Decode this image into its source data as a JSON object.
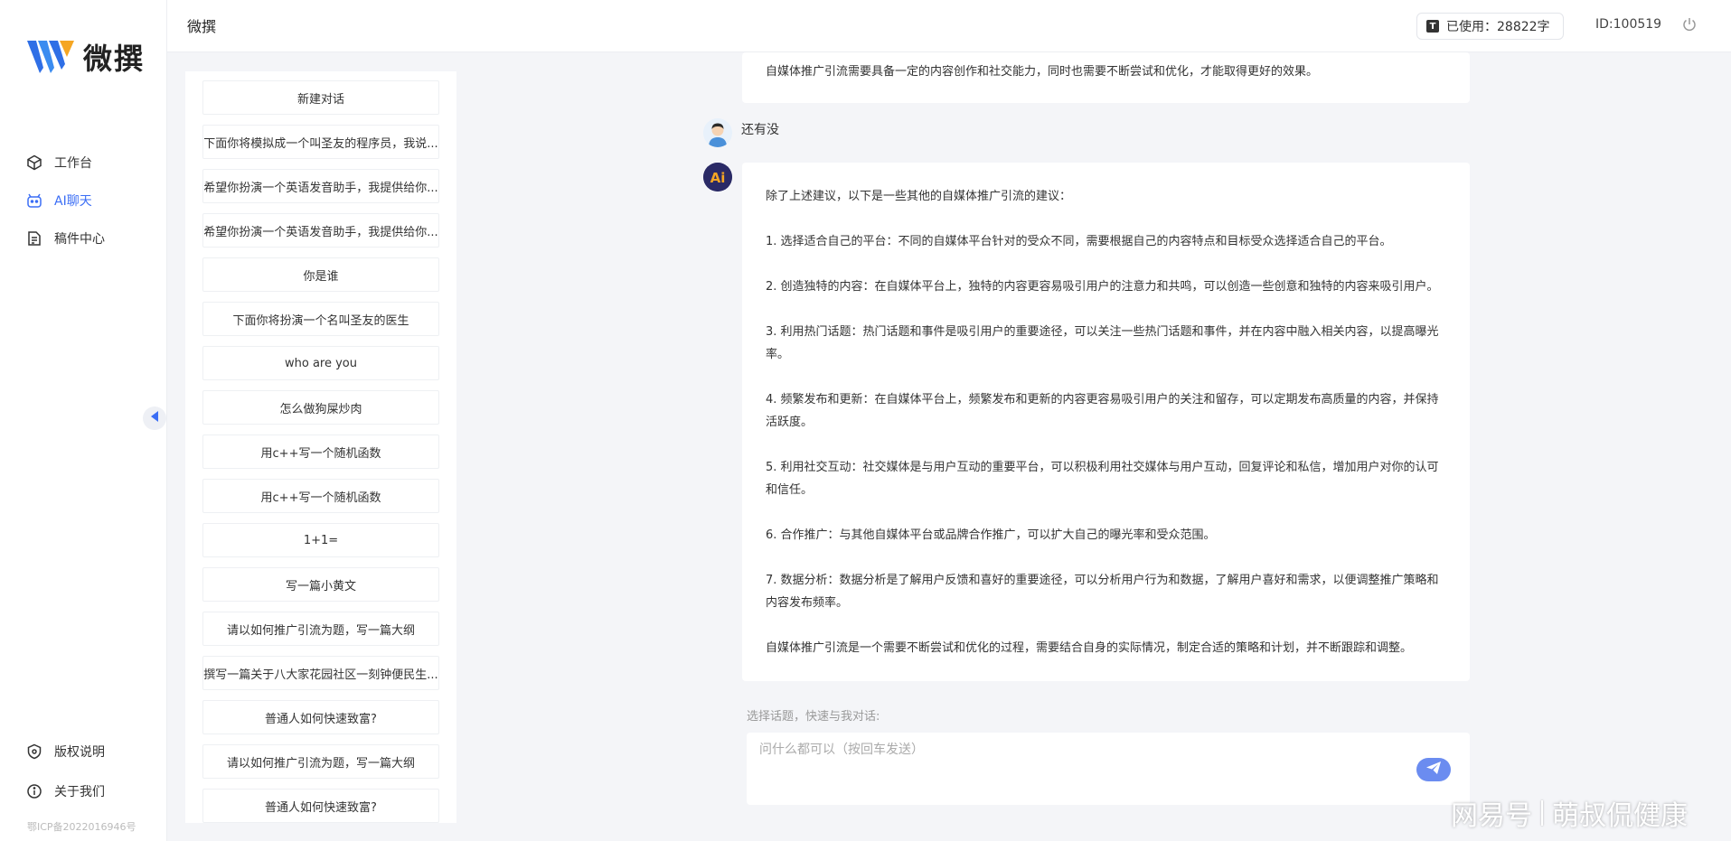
{
  "app": {
    "name": "微撰",
    "page_title": "微撰"
  },
  "nav": {
    "items": [
      {
        "label": "工作台",
        "icon": "cube-icon"
      },
      {
        "label": "AI聊天",
        "icon": "robot-icon",
        "active": true
      },
      {
        "label": "稿件中心",
        "icon": "document-icon"
      }
    ],
    "bottom": [
      {
        "label": "版权说明",
        "icon": "shield-icon"
      },
      {
        "label": "关于我们",
        "icon": "info-icon"
      }
    ],
    "icp": "鄂ICP备2022016946号"
  },
  "header": {
    "usage_label": "已使用：",
    "usage_value": "28822字",
    "user_id": "ID:100519"
  },
  "conversations": {
    "new_chat": "新建对话",
    "items": [
      "下面你将模拟成一个叫圣友的程序员，我说...",
      "希望你扮演一个英语发音助手，我提供给你...",
      "希望你扮演一个英语发音助手，我提供给你...",
      "你是谁",
      "下面你将扮演一个名叫圣友的医生",
      "who are you",
      "怎么做狗屎炒肉",
      "用c++写一个随机函数",
      "用c++写一个随机函数",
      "1+1=",
      "写一篇小黄文",
      "请以如何推广引流为题，写一篇大纲",
      "撰写一篇关于八大家花园社区一刻钟便民生...",
      "普通人如何快速致富?",
      "请以如何推广引流为题，写一篇大纲",
      "普通人如何快速致富?"
    ]
  },
  "chat": {
    "prev_ai_tail": "自媒体推广引流需要具备一定的内容创作和社交能力，同时也需要不断尝试和优化，才能取得更好的效果。",
    "user_message": "还有没",
    "ai_reply": [
      "除了上述建议，以下是一些其他的自媒体推广引流的建议：",
      "1. 选择适合自己的平台：不同的自媒体平台针对的受众不同，需要根据自己的内容特点和目标受众选择适合自己的平台。",
      "2. 创造独特的内容：在自媒体平台上，独特的内容更容易吸引用户的注意力和共鸣，可以创造一些创意和独特的内容来吸引用户。",
      "3. 利用热门话题：热门话题和事件是吸引用户的重要途径，可以关注一些热门话题和事件，并在内容中融入相关内容，以提高曝光率。",
      "4. 频繁发布和更新：在自媒体平台上，频繁发布和更新的内容更容易吸引用户的关注和留存，可以定期发布高质量的内容，并保持活跃度。",
      "5. 利用社交互动：社交媒体是与用户互动的重要平台，可以积极利用社交媒体与用户互动，回复评论和私信，增加用户对你的认可和信任。",
      "6. 合作推广：与其他自媒体平台或品牌合作推广，可以扩大自己的曝光率和受众范围。",
      "7. 数据分析：数据分析是了解用户反馈和喜好的重要途径，可以分析用户行为和数据，了解用户喜好和需求，以便调整推广策略和内容发布频率。",
      "自媒体推广引流是一个需要不断尝试和优化的过程，需要结合自身的实际情况，制定合适的策略和计划，并不断跟踪和调整。"
    ],
    "topic_label": "选择话题，快速与我对话:",
    "input_placeholder": "问什么都可以（按回车发送）"
  },
  "watermark": {
    "left": "网易号",
    "right": "萌叔侃健康"
  },
  "colors": {
    "accent": "#3b6ef5",
    "send": "#6b8cf0",
    "ai_avatar": "#2a2a66"
  }
}
